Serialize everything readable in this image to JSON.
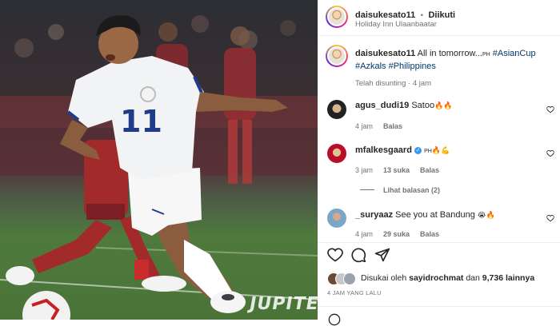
{
  "post_author": {
    "username": "daisukesato11",
    "separator": "•",
    "follow_label": "Diikuti",
    "location": "Holiday Inn Ulaanbaatar"
  },
  "caption": {
    "username": "daisukesato11",
    "text": "All in tomorrow...",
    "flag": "PH",
    "hashtags": [
      "#AsianCup",
      "#Azkals",
      "#Philippines"
    ],
    "edited": "Telah disunting · 4 jam"
  },
  "comments": [
    {
      "username": "agus_dudi19",
      "text": "Satoo",
      "emoji": "🔥🔥",
      "time": "4 jam",
      "likes": "",
      "reply_label": "Balas"
    },
    {
      "username": "mfalkesgaard",
      "verified": true,
      "text": "PH",
      "emoji": "🔥💪",
      "time": "3 jam",
      "likes": "13 suka",
      "reply_label": "Balas",
      "view_replies": "Lihat balasan (2)"
    },
    {
      "username": "_suryaaz",
      "text": "See you at Bandung",
      "emoji": "😭🔥",
      "time": "4 jam",
      "likes": "29 suka",
      "reply_label": "Balas"
    }
  ],
  "likes_summary": {
    "prefix": "Disukai oleh",
    "user": "sayidrochmat",
    "middle": "dan",
    "count": "9,736 lainnya"
  },
  "timestamp": "4 JAM YANG LALU",
  "icons": {
    "like": "heart-icon",
    "comment": "comment-icon",
    "share": "share-icon",
    "comment_like": "heart-outline-icon"
  },
  "photo": {
    "watermark": "JUPITER",
    "jersey_number": "11",
    "colors": {
      "jersey": "#f2f3f5",
      "trim": "#1f3c8a",
      "socks": "#ffffff",
      "opponent": "#a22a2a"
    }
  }
}
